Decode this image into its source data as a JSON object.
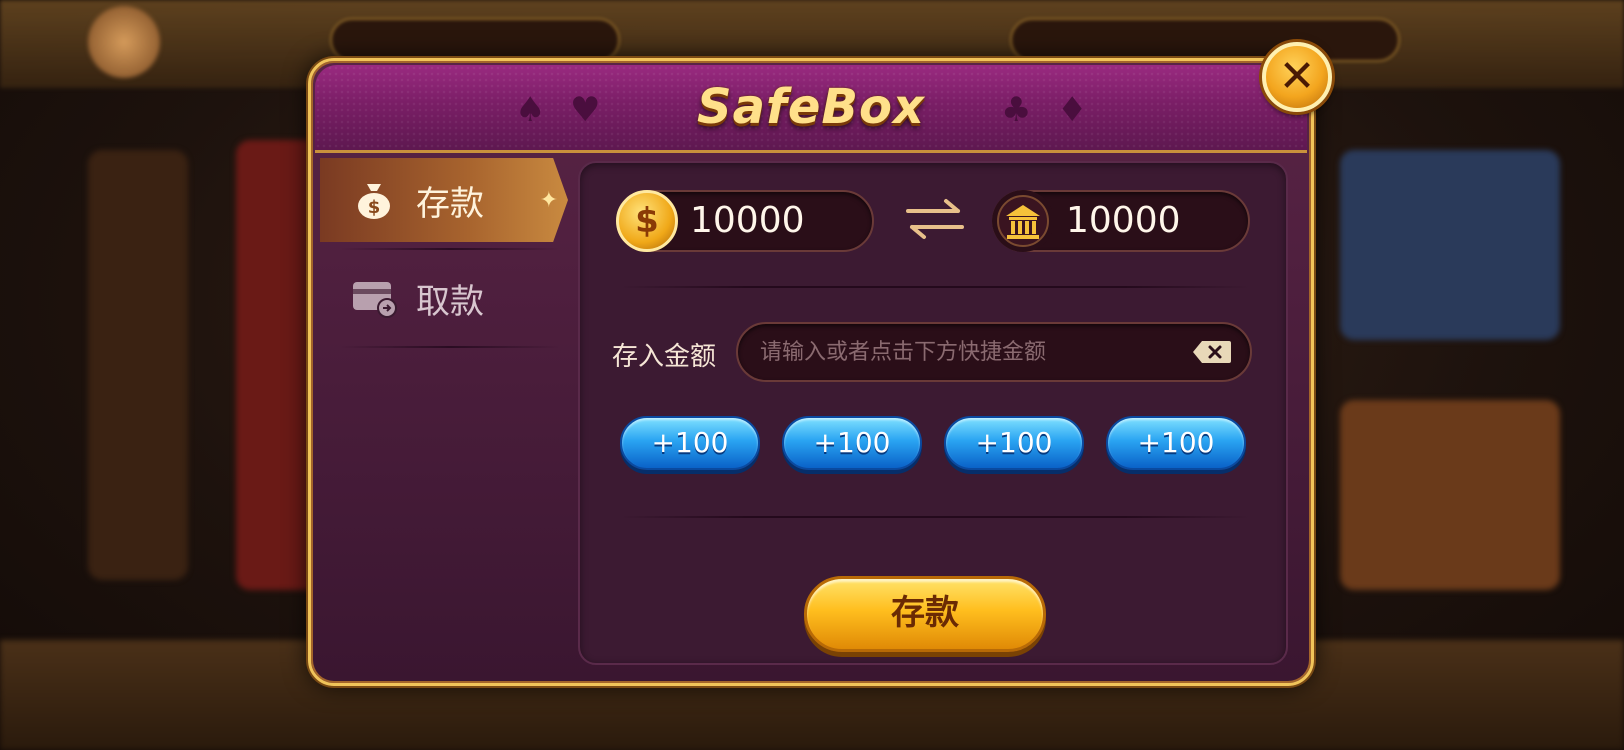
{
  "dialog": {
    "title": "SafeBox"
  },
  "sidebar": {
    "items": [
      {
        "label": "存款",
        "active": true,
        "icon": "money-bag-icon"
      },
      {
        "label": "取款",
        "active": false,
        "icon": "card-withdraw-icon"
      }
    ]
  },
  "balances": {
    "wallet": "10000",
    "bank": "10000"
  },
  "deposit": {
    "amount_label": "存入金额",
    "amount_placeholder": "请输入或者点击下方快捷金额",
    "quick_amounts": [
      "+100",
      "+100",
      "+100",
      "+100"
    ],
    "submit_label": "存款"
  },
  "colors": {
    "header": "#7a1e66",
    "panel": "#3c1a32",
    "gold_border": "#f1c45a",
    "quick_button": "#2aa4f2",
    "submit_button": "#ffbe1e"
  }
}
